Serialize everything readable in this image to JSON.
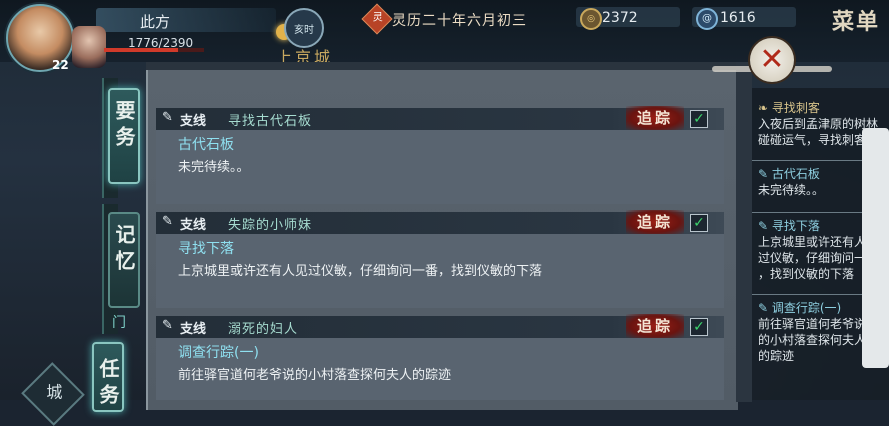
{
  "player": {
    "name": "此方",
    "level": "22",
    "hp": "1776/2390",
    "hp_fraction": 0.743
  },
  "top": {
    "time_label": "亥时",
    "date_mark": "灵",
    "date": "灵历二十年六月初三",
    "currency1_icon": "coin-icon",
    "currency1": "2372",
    "currency2_icon": "spiral-icon",
    "currency2": "1616",
    "menu": "菜单",
    "location": "上京城"
  },
  "tabs": {
    "quest": "要务",
    "memory": "记忆",
    "memory_sub": "门",
    "task": "任务",
    "city": "城"
  },
  "quests": [
    {
      "type": "支线",
      "title": "寻找古代石板",
      "track": "追踪",
      "checked": true,
      "step": "古代石板",
      "desc": "未完待续。。"
    },
    {
      "type": "支线",
      "title": "失踪的小师妹",
      "track": "追踪",
      "checked": true,
      "step": "寻找下落",
      "desc": "上京城里或许还有人见过仪敏，仔细询问一番，找到仪敏的下落"
    },
    {
      "type": "支线",
      "title": "溺死的妇人",
      "track": "追踪",
      "checked": true,
      "step": "调查行踪(一)",
      "desc": "前往驿官道何老爷说的小村落查探何夫人的踪迹"
    }
  ],
  "right_list": [
    {
      "title": "寻找刺客",
      "lines": [
        "入夜后到孟津原的树林",
        "碰碰运气，寻找刺客"
      ]
    },
    {
      "title": "古代石板",
      "lines": [
        "未完待续。。"
      ]
    },
    {
      "title": "寻找下落",
      "lines": [
        "上京城里或许还有人见",
        "过仪敏，仔细询问一番",
        "，找到仪敏的下落"
      ]
    },
    {
      "title": "调查行踪(一)",
      "lines": [
        "前往驿官道何老爷说",
        "的小村落查探何夫人",
        "的踪迹"
      ]
    }
  ],
  "close_label": "✕"
}
